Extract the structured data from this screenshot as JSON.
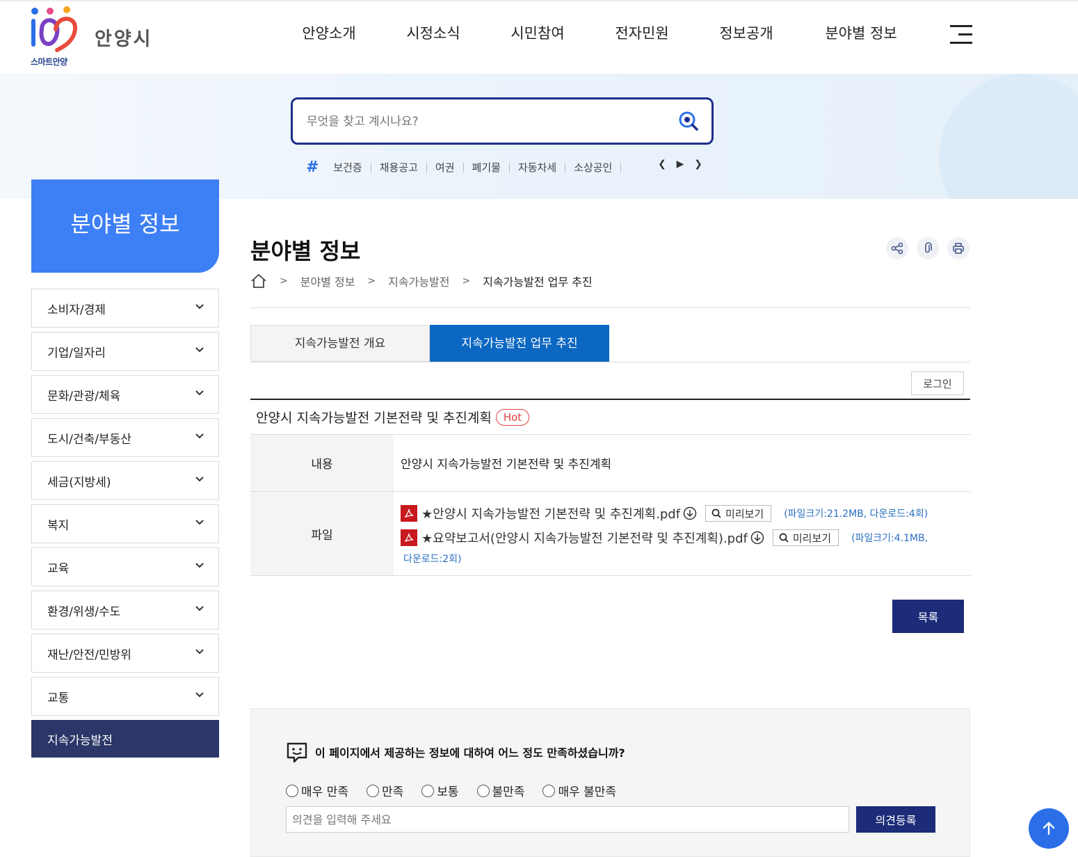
{
  "header": {
    "logo_sub": "스마트안양",
    "logo_name": "안양시",
    "nav": [
      "안양소개",
      "시정소식",
      "시민참여",
      "전자민원",
      "정보공개",
      "분야별 정보"
    ]
  },
  "search": {
    "placeholder": "무엇을 찾고 계시나요?",
    "keywords": [
      "보건증",
      "채용공고",
      "여권",
      "폐기물",
      "자동차세",
      "소상공인"
    ]
  },
  "sidebar": {
    "title": "분야별 정보",
    "items": [
      {
        "label": "소비자/경제"
      },
      {
        "label": "기업/일자리"
      },
      {
        "label": "문화/관광/체육"
      },
      {
        "label": "도시/건축/부동산"
      },
      {
        "label": "세금(지방세)"
      },
      {
        "label": "복지"
      },
      {
        "label": "교육"
      },
      {
        "label": "환경/위생/수도"
      },
      {
        "label": "재난/안전/민방위"
      },
      {
        "label": "교통"
      },
      {
        "label": "지속가능발전"
      }
    ]
  },
  "content": {
    "page_title": "분야별 정보",
    "breadcrumb": [
      "분야별 정보",
      "지속가능발전",
      "지속가능발전 업무 추진"
    ],
    "tabs": [
      "지속가능발전 개요",
      "지속가능발전 업무 추진"
    ],
    "active_tab": 1,
    "login_label": "로그인",
    "board": {
      "title": "안양시 지속가능발전 기본전략 및 추진계획",
      "badge": "Hot",
      "content_label": "내용",
      "content_value": "안양시 지속가능발전 기본전략 및 추진계획",
      "file_label": "파일",
      "files": [
        {
          "name": "★안양시 지속가능발전 기본전략 및 추진계획.pdf",
          "preview": "미리보기",
          "meta": "(파일크기:21.2MB, 다운로드:4회)"
        },
        {
          "name": "★요약보고서(안양시 지속가능발전 기본전략 및 추진계획).pdf",
          "preview": "미리보기",
          "meta_a": "(파일크기:4.1MB,",
          "meta_b": "다운로드:2회)"
        }
      ]
    },
    "list_button": "목록"
  },
  "survey": {
    "question": "이 페이지에서 제공하는 정보에 대하여 어느 정도 만족하셨습니까?",
    "options": [
      "매우 만족",
      "만족",
      "보통",
      "불만족",
      "매우 불만족"
    ],
    "input_placeholder": "의견을 입력해 주세요",
    "submit_label": "의견등록"
  },
  "colors": {
    "primary_blue": "#3d7ff5",
    "navy": "#1c2c78",
    "tab_active": "#0b67c2",
    "sidebar_active": "#2d3668",
    "hot_red": "#e04040",
    "pdf_red": "#c8191e"
  }
}
